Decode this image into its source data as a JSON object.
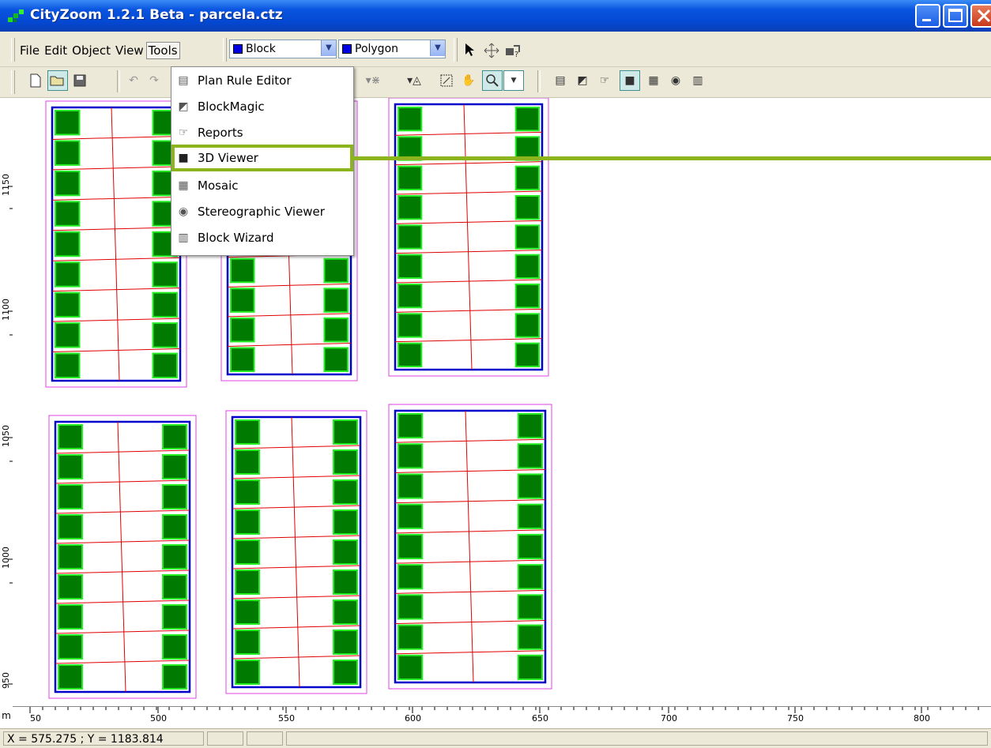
{
  "window": {
    "title": "CityZoom 1.2.1 Beta - parcela.ctz"
  },
  "menubar": {
    "items": [
      "File",
      "Edit",
      "Object",
      "View",
      "Tools"
    ],
    "active": "Tools"
  },
  "combos": {
    "layer": "Block",
    "shape": "Polygon"
  },
  "tools_menu": {
    "items": [
      {
        "label": "Plan Rule Editor",
        "icon": "plan-rule-editor-icon"
      },
      {
        "label": "BlockMagic",
        "icon": "blockmagic-icon"
      },
      {
        "label": "Reports",
        "icon": "reports-icon"
      },
      {
        "label": "3D Viewer",
        "icon": "3d-viewer-icon",
        "highlighted": true
      },
      {
        "label": "Mosaic",
        "icon": "mosaic-icon"
      },
      {
        "label": "Stereographic Viewer",
        "icon": "stereographic-viewer-icon"
      },
      {
        "label": "Block Wizard",
        "icon": "block-wizard-icon"
      }
    ]
  },
  "rulers": {
    "unit": "m",
    "x_ticks": [
      "50",
      "500",
      "550",
      "600",
      "650",
      "700",
      "750",
      "800"
    ],
    "y_ticks": [
      "1150",
      "1100",
      "1050",
      "1000",
      "950"
    ]
  },
  "status": {
    "coords": "X = 575.275 ;  Y = 1183.814"
  },
  "colors": {
    "highlight": "#8cb41c",
    "block_outline": "#0000cc",
    "setback": "#e040e0",
    "lot_line": "#e00000",
    "building_fill": "#007a00",
    "building_edge": "#22ee22"
  }
}
